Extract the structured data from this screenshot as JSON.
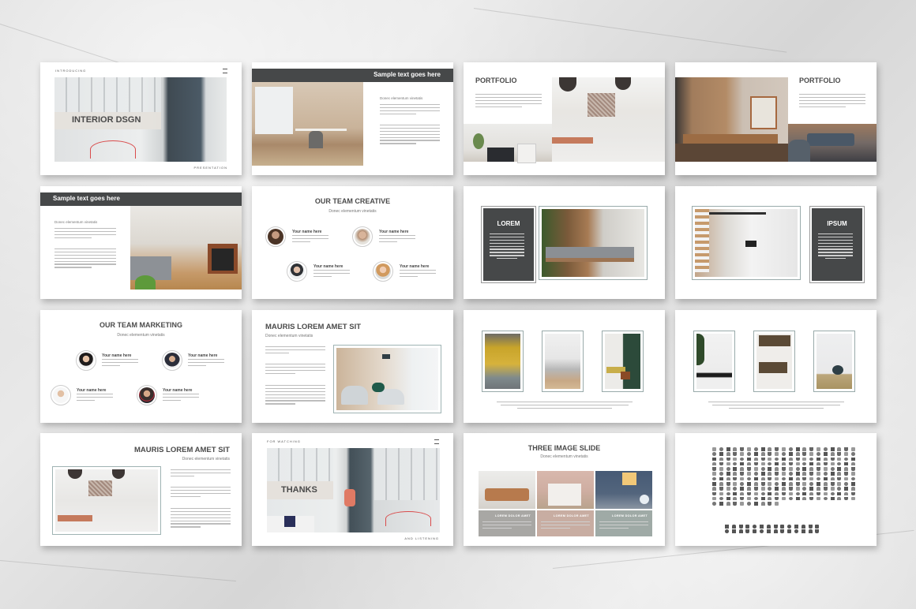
{
  "background": {
    "style": "marble",
    "color": "#e2e2e2"
  },
  "colors": {
    "dark_bar": "#464849",
    "title_text": "#4a4a4a",
    "card_gray": "#a8a7a4",
    "card_pink": "#c8ada2",
    "card_sage": "#9faaa6"
  },
  "slides": [
    {
      "id": 1,
      "type": "cover",
      "top_label": "INTRODUCING",
      "title": "INTERIOR DSGN",
      "bottom_label": "PRESENTATION",
      "menu_icon": "hamburger-icon"
    },
    {
      "id": 2,
      "type": "image-text",
      "header": "Sample text goes here",
      "subheading": "Donec elementum vinetatis"
    },
    {
      "id": 3,
      "type": "portfolio",
      "title": "PORTFOLIO"
    },
    {
      "id": 4,
      "type": "portfolio",
      "title": "PORTFOLIO"
    },
    {
      "id": 5,
      "type": "text-image",
      "header": "Sample text goes here",
      "subheading": "Donec elementum vinetatis"
    },
    {
      "id": 6,
      "type": "team",
      "title": "OUR TEAM CREATIVE",
      "subtitle": "Donec elementum vinetatis",
      "members": [
        {
          "name": "Your name here"
        },
        {
          "name": "Your name here"
        },
        {
          "name": "Your name here"
        },
        {
          "name": "Your name here"
        }
      ]
    },
    {
      "id": 7,
      "type": "box-image",
      "box_title": "LOREM"
    },
    {
      "id": 8,
      "type": "image-box",
      "box_title": "IPSUM"
    },
    {
      "id": 9,
      "type": "team",
      "title": "OUR TEAM MARKETING",
      "subtitle": "Donec elementum vinetatis",
      "members": [
        {
          "name": "Your name here"
        },
        {
          "name": "Your name here"
        },
        {
          "name": "Your name here"
        },
        {
          "name": "Your name here"
        }
      ]
    },
    {
      "id": 10,
      "type": "text-image",
      "title": "MAURIS LOREM AMET SIT",
      "subtitle": "Donec elementum vinetatis"
    },
    {
      "id": 11,
      "type": "three-frames"
    },
    {
      "id": 12,
      "type": "three-frames"
    },
    {
      "id": 13,
      "type": "image-text",
      "title": "MAURIS LOREM AMET SIT",
      "subtitle": "Donec elementum vinetatis"
    },
    {
      "id": 14,
      "type": "closing",
      "top_label": "FOR WATCHING",
      "title": "THANKS",
      "bottom_label": "AND LISTENING",
      "menu_icon": "hamburger-icon"
    },
    {
      "id": 15,
      "type": "three-image",
      "title": "THREE IMAGE SLIDE",
      "subtitle": "Donec elementum vinetatis",
      "cards": [
        {
          "label": "LOREM DOLOR AMET"
        },
        {
          "label": "LOREM DOLOR AMET"
        },
        {
          "label": "LOREM DOLOR AMET"
        }
      ]
    },
    {
      "id": 16,
      "type": "icon-set"
    }
  ]
}
